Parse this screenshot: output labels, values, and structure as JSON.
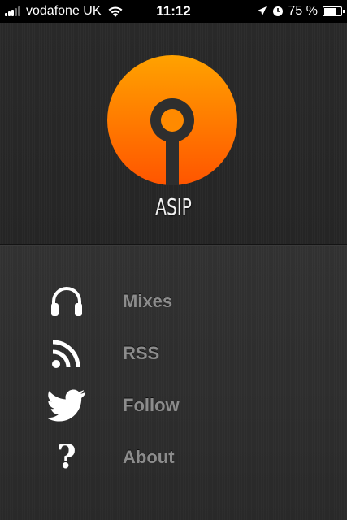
{
  "status_bar": {
    "carrier": "vodafone UK",
    "time": "11:12",
    "battery_percent": "75 %",
    "battery_level": 0.75,
    "signal_bars": 3,
    "icons": [
      "signal-icon",
      "wifi-icon",
      "location-arrow-icon",
      "clock-icon",
      "battery-icon"
    ]
  },
  "header": {
    "logo_text": "ASIP",
    "logo_colors": {
      "top": "#ffa000",
      "bottom": "#ff5a00"
    }
  },
  "menu": {
    "items": [
      {
        "label": "Mixes",
        "icon": "headphones-icon"
      },
      {
        "label": "RSS",
        "icon": "rss-icon"
      },
      {
        "label": "Follow",
        "icon": "twitter-bird-icon"
      },
      {
        "label": "About",
        "icon": "question-mark-icon",
        "glyph": "?"
      }
    ]
  }
}
